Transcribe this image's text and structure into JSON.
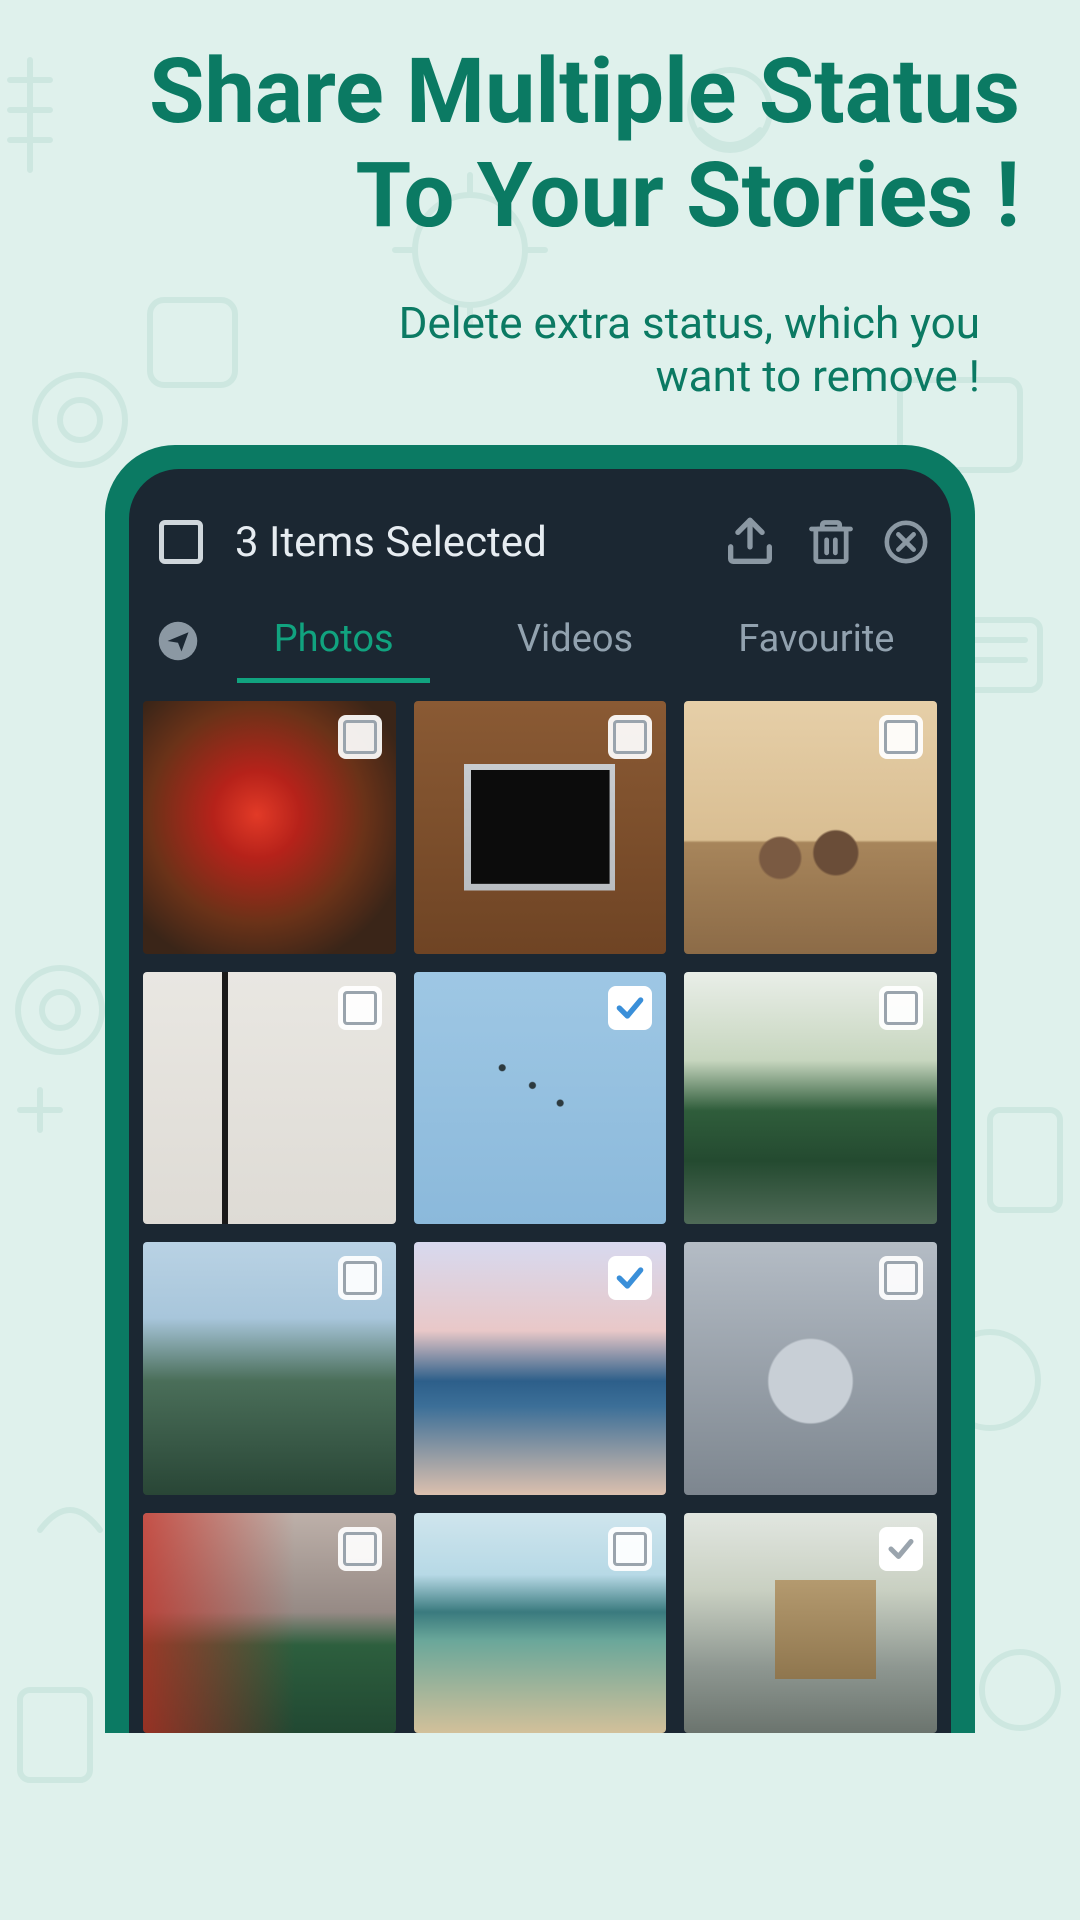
{
  "headline_line1": "Share Multiple Status",
  "headline_line2": "To Your Stories !",
  "subhead_line1": "Delete extra status, which you",
  "subhead_line2": "want to remove !",
  "appbar": {
    "title": "3 Items Selected",
    "selected_count": 3
  },
  "tabs": {
    "photos": "Photos",
    "videos": "Videos",
    "favourite": "Favourite",
    "active": "photos"
  },
  "grid": [
    {
      "name": "red-bird",
      "checked": false
    },
    {
      "name": "laptop-desk",
      "checked": false
    },
    {
      "name": "elephants",
      "checked": false
    },
    {
      "name": "street-lamp",
      "checked": false
    },
    {
      "name": "flying-birds",
      "checked": true
    },
    {
      "name": "river-forest",
      "checked": false
    },
    {
      "name": "mountains",
      "checked": false
    },
    {
      "name": "beach-sunset",
      "checked": true
    },
    {
      "name": "bicycle-close",
      "checked": false
    },
    {
      "name": "racecar-blur",
      "checked": false
    },
    {
      "name": "coastline",
      "checked": false
    },
    {
      "name": "village-street",
      "checked": true
    }
  ],
  "icons": {
    "select_all": "checkbox-empty-icon",
    "share": "share-icon",
    "delete": "trash-icon",
    "close": "close-circle-icon",
    "send": "send-icon"
  },
  "colors": {
    "brand": "#0b7a63",
    "accent": "#11a37f",
    "screen_bg": "#1b2732",
    "page_bg": "#dff1ec"
  }
}
